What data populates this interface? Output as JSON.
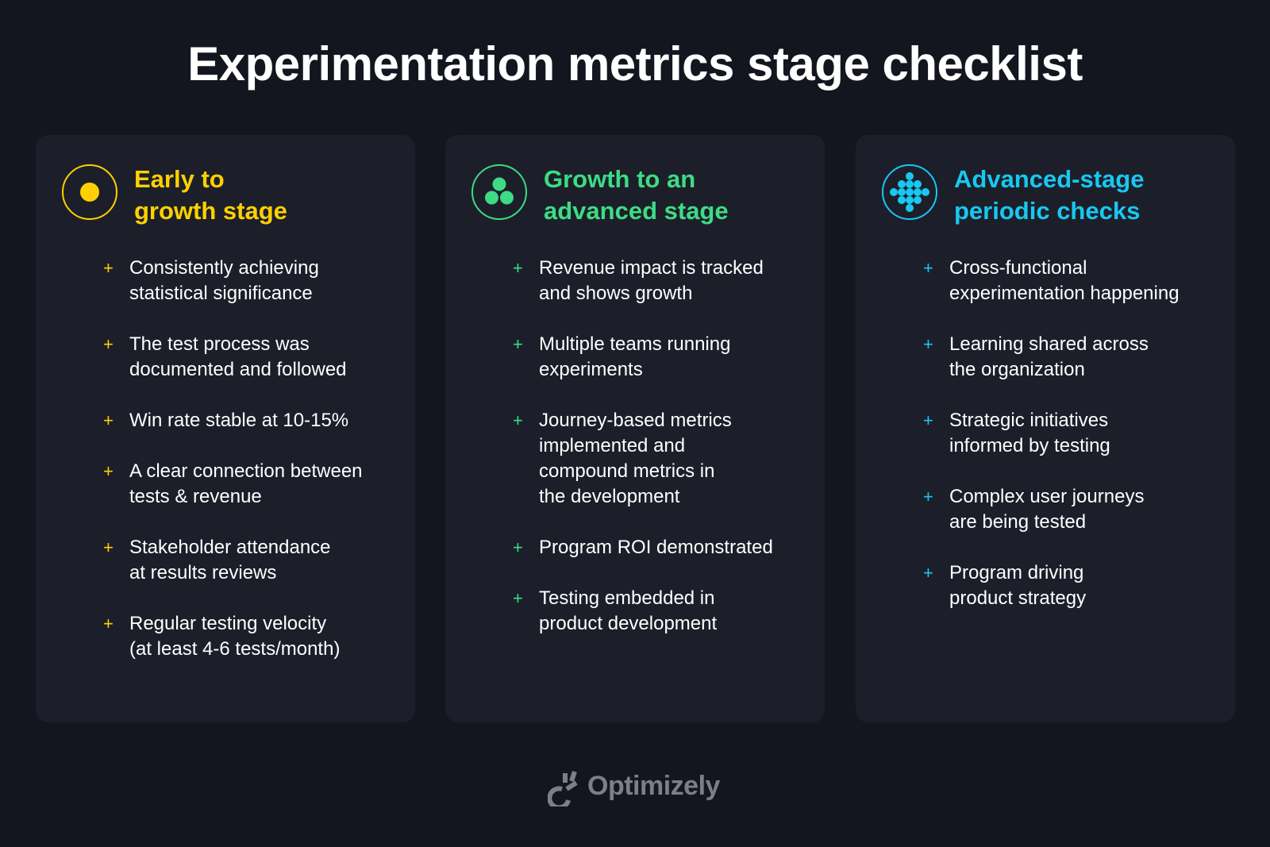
{
  "title": "Experimentation metrics stage checklist",
  "colors": {
    "yellow": "#ffd000",
    "green": "#3ddc84",
    "cyan": "#18c8f0"
  },
  "cards": [
    {
      "icon": "target-dot-icon",
      "title": "Early to\ngrowth stage",
      "items": [
        "Consistently achieving\nstatistical significance",
        "The test process was\ndocumented and followed",
        "Win rate stable at 10-15%",
        "A clear connection between\ntests & revenue",
        "Stakeholder attendance\nat results reviews",
        "Regular testing velocity\n(at least 4-6 tests/month)"
      ]
    },
    {
      "icon": "three-dots-icon",
      "title": "Growth to an\nadvanced stage",
      "items": [
        "Revenue impact is tracked\nand shows growth",
        "Multiple teams running\nexperiments",
        "Journey-based metrics\nimplemented and\ncompound metrics in\nthe development",
        "Program ROI demonstrated",
        "Testing embedded in\nproduct development"
      ]
    },
    {
      "icon": "dot-grid-diamond-icon",
      "title": "Advanced-stage\nperiodic checks",
      "items": [
        "Cross-functional\nexperimentation happening",
        "Learning shared across\nthe organization",
        "Strategic initiatives\ninformed by testing",
        "Complex user journeys\nare being tested",
        "Program driving\nproduct strategy"
      ]
    }
  ],
  "bullet_symbol": "+",
  "footer": {
    "brand": "Optimizely"
  }
}
